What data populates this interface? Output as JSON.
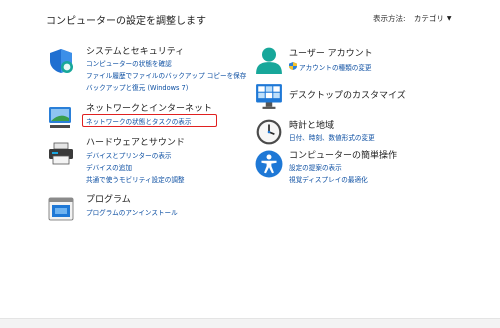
{
  "page": {
    "title": "コンピューターの設定を調整します"
  },
  "view_by": {
    "label": "表示方法:",
    "value": "カテゴリ"
  },
  "categories": {
    "system": {
      "title": "システムとセキュリティ",
      "links": [
        "コンピューターの状態を確認",
        "ファイル履歴でファイルのバックアップ コピーを保存",
        "バックアップと復元 (Windows 7)"
      ]
    },
    "network": {
      "title": "ネットワークとインターネット",
      "links": [
        "ネットワークの状態とタスクの表示"
      ]
    },
    "hardware": {
      "title": "ハードウェアとサウンド",
      "links": [
        "デバイスとプリンターの表示",
        "デバイスの追加",
        "共通で使うモビリティ設定の調整"
      ]
    },
    "programs": {
      "title": "プログラム",
      "links": [
        "プログラムのアンインストール"
      ]
    },
    "users": {
      "title": "ユーザー アカウント",
      "links": [
        "アカウントの種類の変更"
      ]
    },
    "appearance": {
      "title": "デスクトップのカスタマイズ",
      "links": []
    },
    "clock": {
      "title": "時計と地域",
      "links": [
        "日付、時刻、数値形式の変更"
      ]
    },
    "ease": {
      "title": "コンピューターの簡単操作",
      "links": [
        "設定の提案の表示",
        "視覚ディスプレイの最適化"
      ]
    }
  },
  "colors": {
    "link": "#0b4ea2",
    "highlight": "#e02020",
    "accent": "#1e78d6"
  },
  "icons": [
    "shield-icon",
    "network-icon",
    "printer-icon",
    "programs-icon",
    "user-icon",
    "desktop-icon",
    "clock-icon",
    "accessibility-icon"
  ]
}
